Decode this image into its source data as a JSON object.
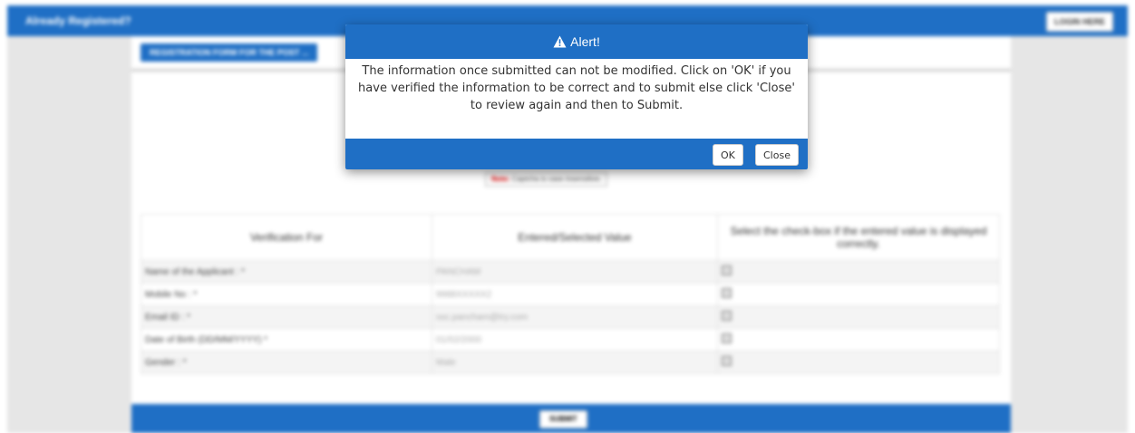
{
  "top_bar": {
    "title": "Already Registered?",
    "login_label": "LOGIN HERE"
  },
  "form": {
    "tab_label": "REGISTRATION FORM FOR THE POST ...",
    "captcha_note_red": "Note:",
    "captcha_note_rest": "Captcha is case insensitive.",
    "table_headers": [
      "Verification For",
      "Entered/Selected Value",
      "Select the check-box if the entered value is displayed correctly."
    ],
    "rows": [
      {
        "label": "Name of the Applicant : *",
        "value": "PANCHAM"
      },
      {
        "label": "Mobile No : *",
        "value": "9988XXXXX2"
      },
      {
        "label": "Email ID : *",
        "value": "ssc.pancham@try.com"
      },
      {
        "label": "Date of Birth (DD/MM/YYYY) *",
        "value": "01/02/2000"
      },
      {
        "label": "Gender : *",
        "value": "Male"
      }
    ],
    "submit_label": "SUBMIT"
  },
  "modal": {
    "title": "Alert!",
    "message": "The information once submitted can not be modified. Click on 'OK' if you have verified the information to be correct and to submit else click 'Close' to review again and then to Submit.",
    "ok_label": "OK",
    "close_label": "Close"
  },
  "colors": {
    "primary": "#1f6fc5",
    "background": "#e6e6e6"
  },
  "icons": {
    "alert": "warning-triangle-icon"
  }
}
